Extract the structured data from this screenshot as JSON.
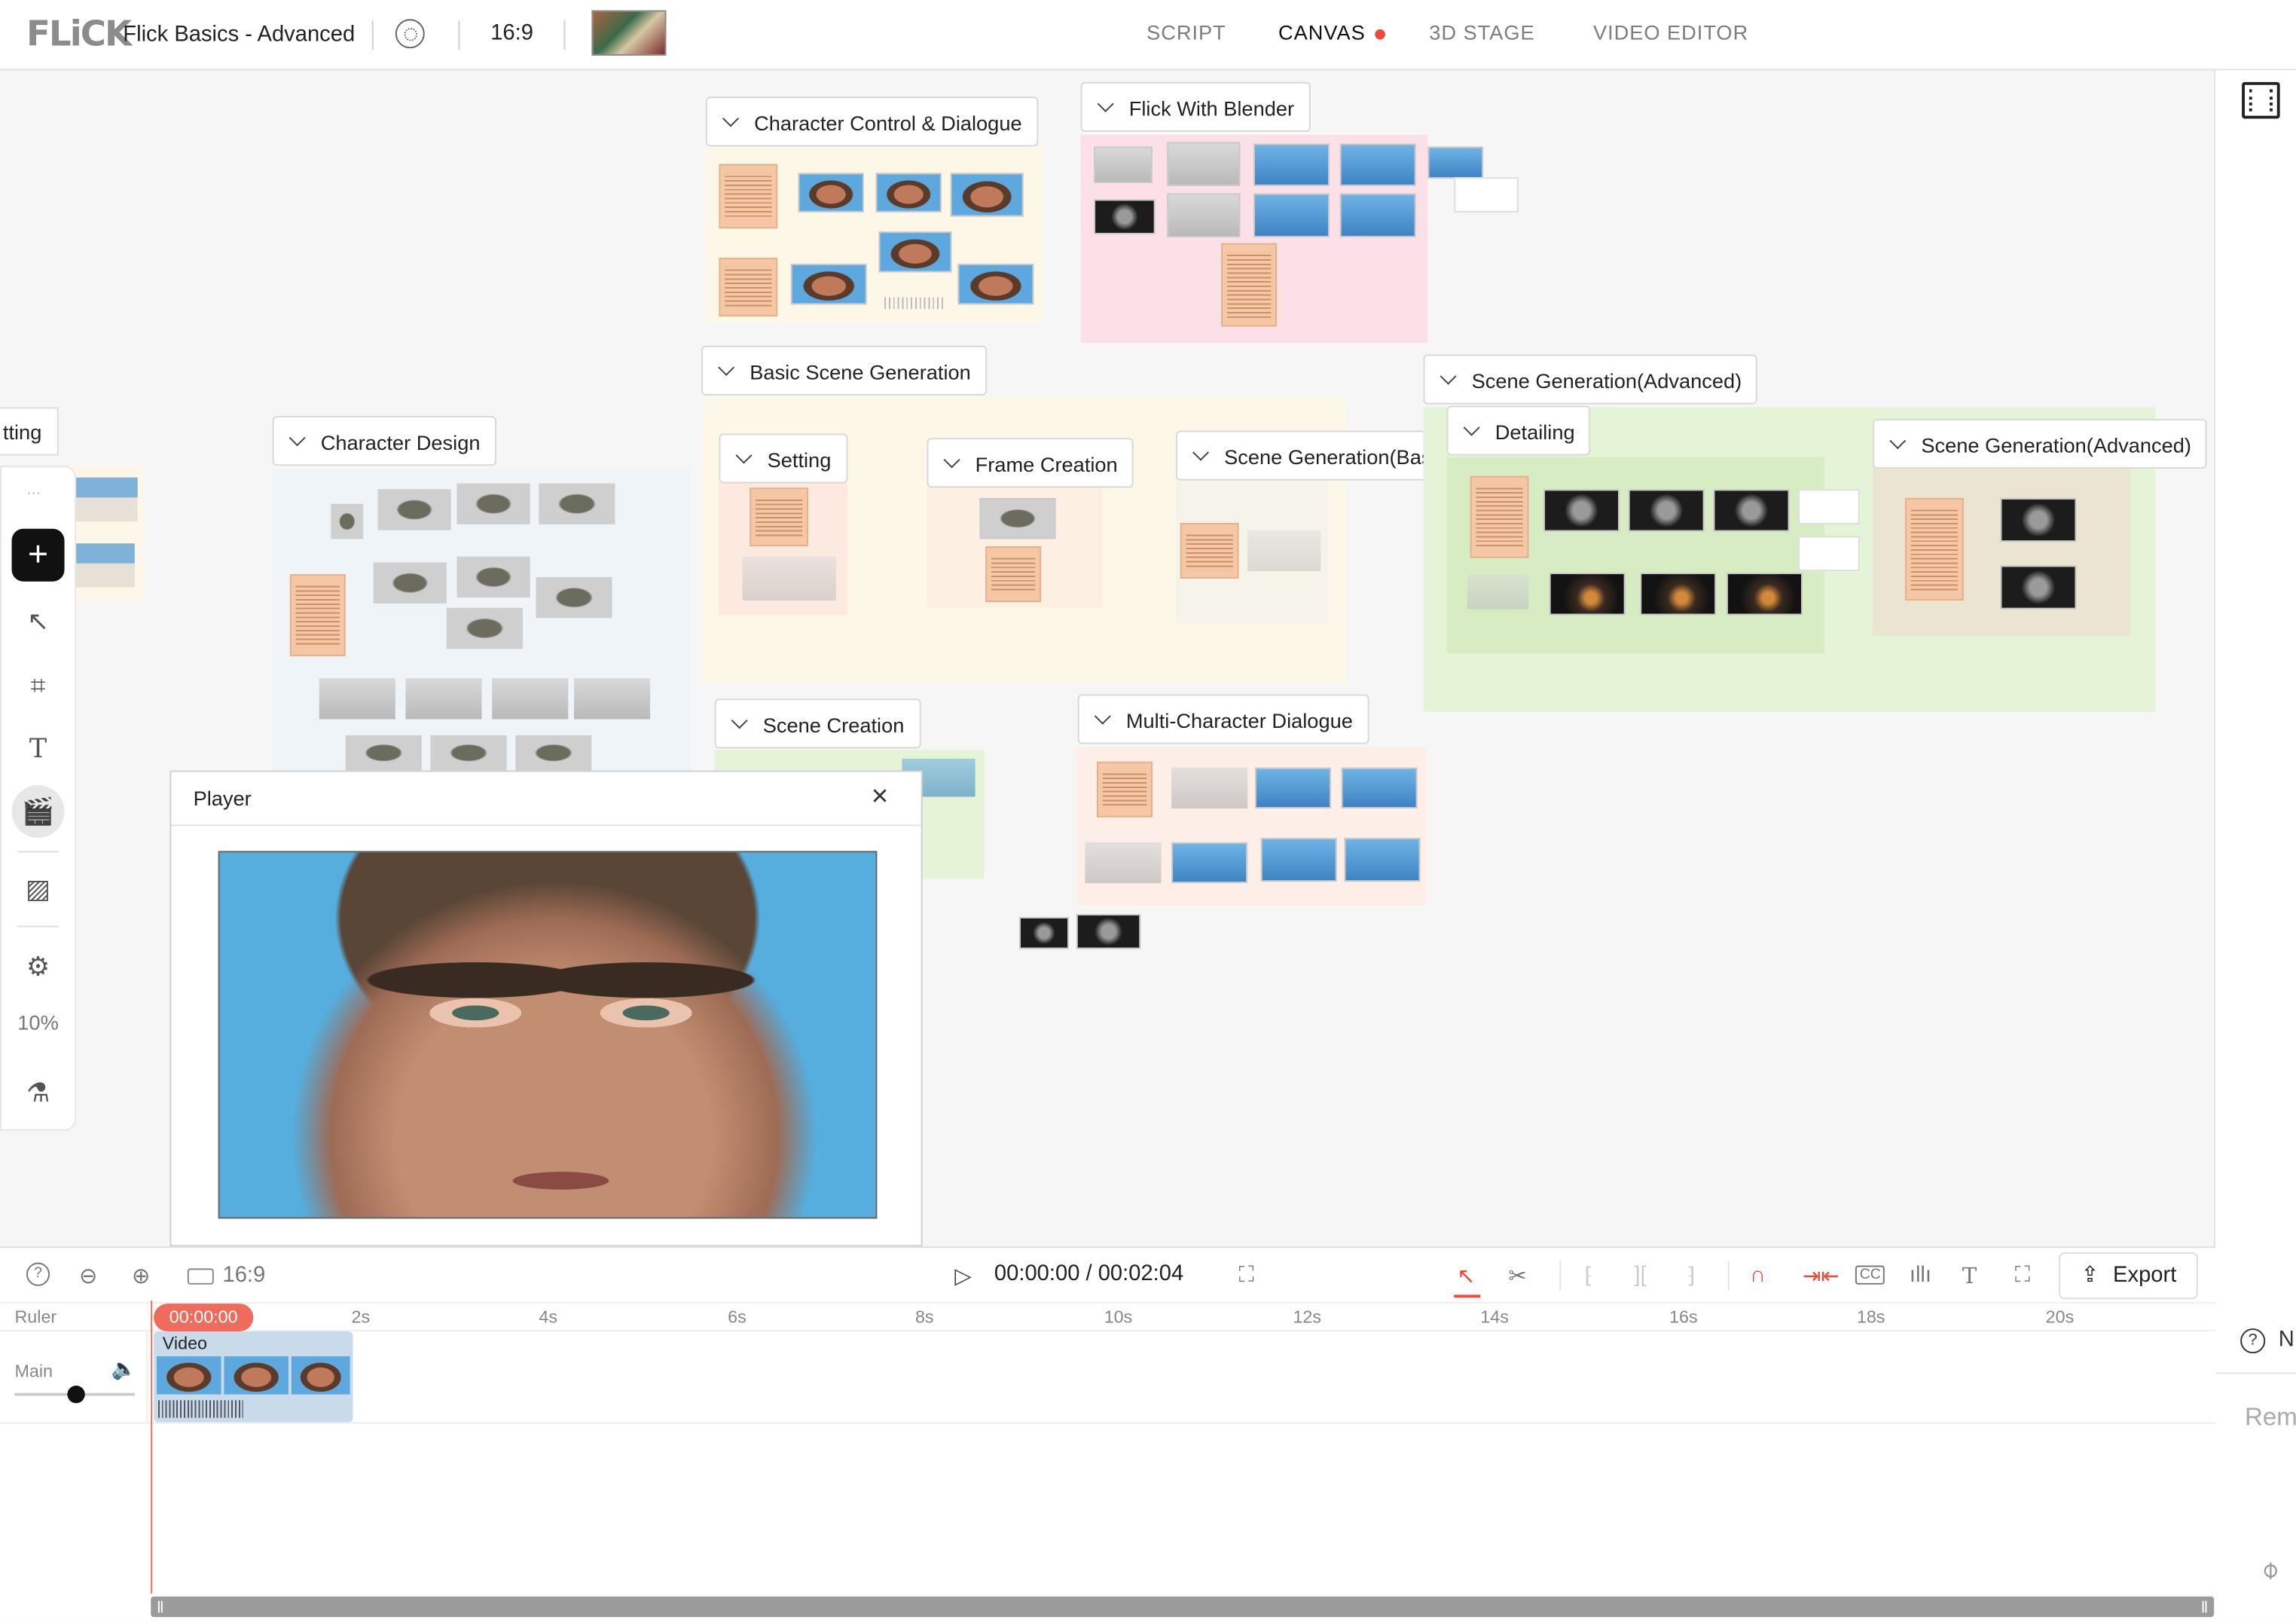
{
  "header": {
    "logo": "FLiCK",
    "project_name": "Flick Basics - Advanced",
    "aspect_ratio": "16:9",
    "tabs": [
      {
        "label": "SCRIPT",
        "active": false
      },
      {
        "label": "CANVAS",
        "active": true
      },
      {
        "label": "3D STAGE",
        "active": false
      },
      {
        "label": "VIDEO EDITOR",
        "active": false
      }
    ],
    "active_dot_color": "#ef4b3a"
  },
  "left_toolbar": {
    "partial_label": "tting",
    "zoom": "10%"
  },
  "canvas_groups": {
    "g1": "Character Control & Dialogue",
    "g2": "Flick With Blender",
    "g3": "Basic Scene Generation",
    "g4": "Scene Generation(Advanced)",
    "g5": "Character Design",
    "g6": "Setting",
    "g7": "Frame Creation",
    "g8": "Scene Generation(Basic)",
    "g9": "Detailing",
    "g10": "Scene Generation(Advanced)",
    "g11": "Scene Creation",
    "g12": "Multi-Character Dialogue"
  },
  "player": {
    "title": "Player",
    "close": "×"
  },
  "timeline": {
    "ratio": "16:9",
    "time": "00:00:00 / 00:02:04",
    "export_label": "Export",
    "ruler_label": "Ruler",
    "playhead": "00:00:00",
    "ticks": [
      "2s",
      "4s",
      "6s",
      "8s",
      "10s",
      "12s",
      "14s",
      "16s",
      "18s",
      "20s"
    ],
    "track_name": "Main",
    "clip_label": "Video",
    "accent_color": "#ef6b5b"
  },
  "right_panel": {
    "partial_help": "N",
    "partial_text": "Rem"
  }
}
